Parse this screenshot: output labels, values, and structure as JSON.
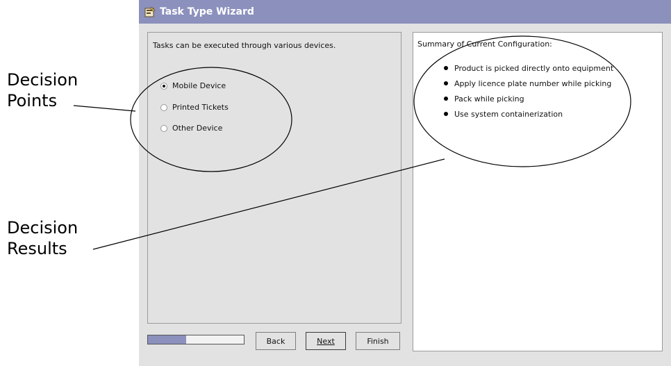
{
  "window": {
    "title": "Task Type Wizard",
    "icon": "wizard-icon"
  },
  "left_panel": {
    "intro": "Tasks can be executed through various devices.",
    "options": [
      {
        "label": "Mobile Device",
        "selected": true
      },
      {
        "label": "Printed Tickets",
        "selected": false
      },
      {
        "label": "Other Device",
        "selected": false
      }
    ]
  },
  "right_panel": {
    "title": "Summary of Current Configuration:",
    "items": [
      "Product is picked directly onto equipment",
      "Apply licence plate number while picking",
      "Pack while picking",
      "Use system containerization"
    ]
  },
  "progress": {
    "fraction": 0.4
  },
  "buttons": {
    "back": "Back",
    "next": "Next",
    "finish": "Finish"
  },
  "callouts": {
    "points_line1": "Decision",
    "points_line2": "Points",
    "results_line1": "Decision",
    "results_line2": "Results"
  },
  "colors": {
    "titlebar": "#8c90bd",
    "panel": "#e2e2e2"
  }
}
